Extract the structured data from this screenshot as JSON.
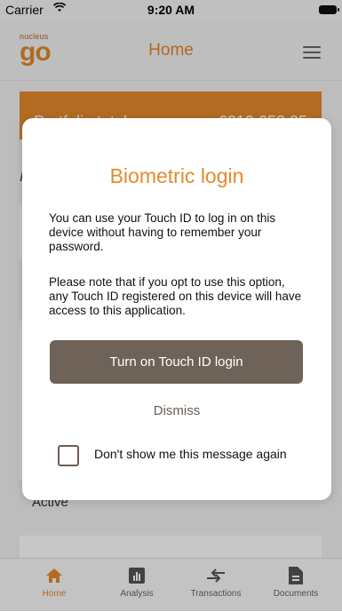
{
  "status_bar": {
    "carrier": "Carrier",
    "time": "9:20 AM"
  },
  "header": {
    "logo_small": "nucleus",
    "logo_big": "go",
    "title": "Home"
  },
  "background": {
    "portfolio_label": "Portfolio total",
    "portfolio_value": "£219,653.25",
    "side_letter": "I",
    "active_label": "Active"
  },
  "modal": {
    "title": "Biometric login",
    "paragraph1": "You can use your Touch ID to log in on this device without having to remember your password.",
    "paragraph2": "Please note that if you opt to use this option, any Touch ID registered on this device will have access to this application.",
    "primary_button": "Turn on Touch ID login",
    "dismiss": "Dismiss",
    "checkbox_label": "Don't show me this message again"
  },
  "tab_bar": {
    "tabs": [
      {
        "label": "Home",
        "icon": "home-icon",
        "active": true
      },
      {
        "label": "Analysis",
        "icon": "analysis-icon"
      },
      {
        "label": "Transactions",
        "icon": "transactions-icon"
      },
      {
        "label": "Documents",
        "icon": "documents-icon"
      }
    ]
  },
  "colors": {
    "accent": "#e58a2c",
    "button": "#6f6258"
  }
}
